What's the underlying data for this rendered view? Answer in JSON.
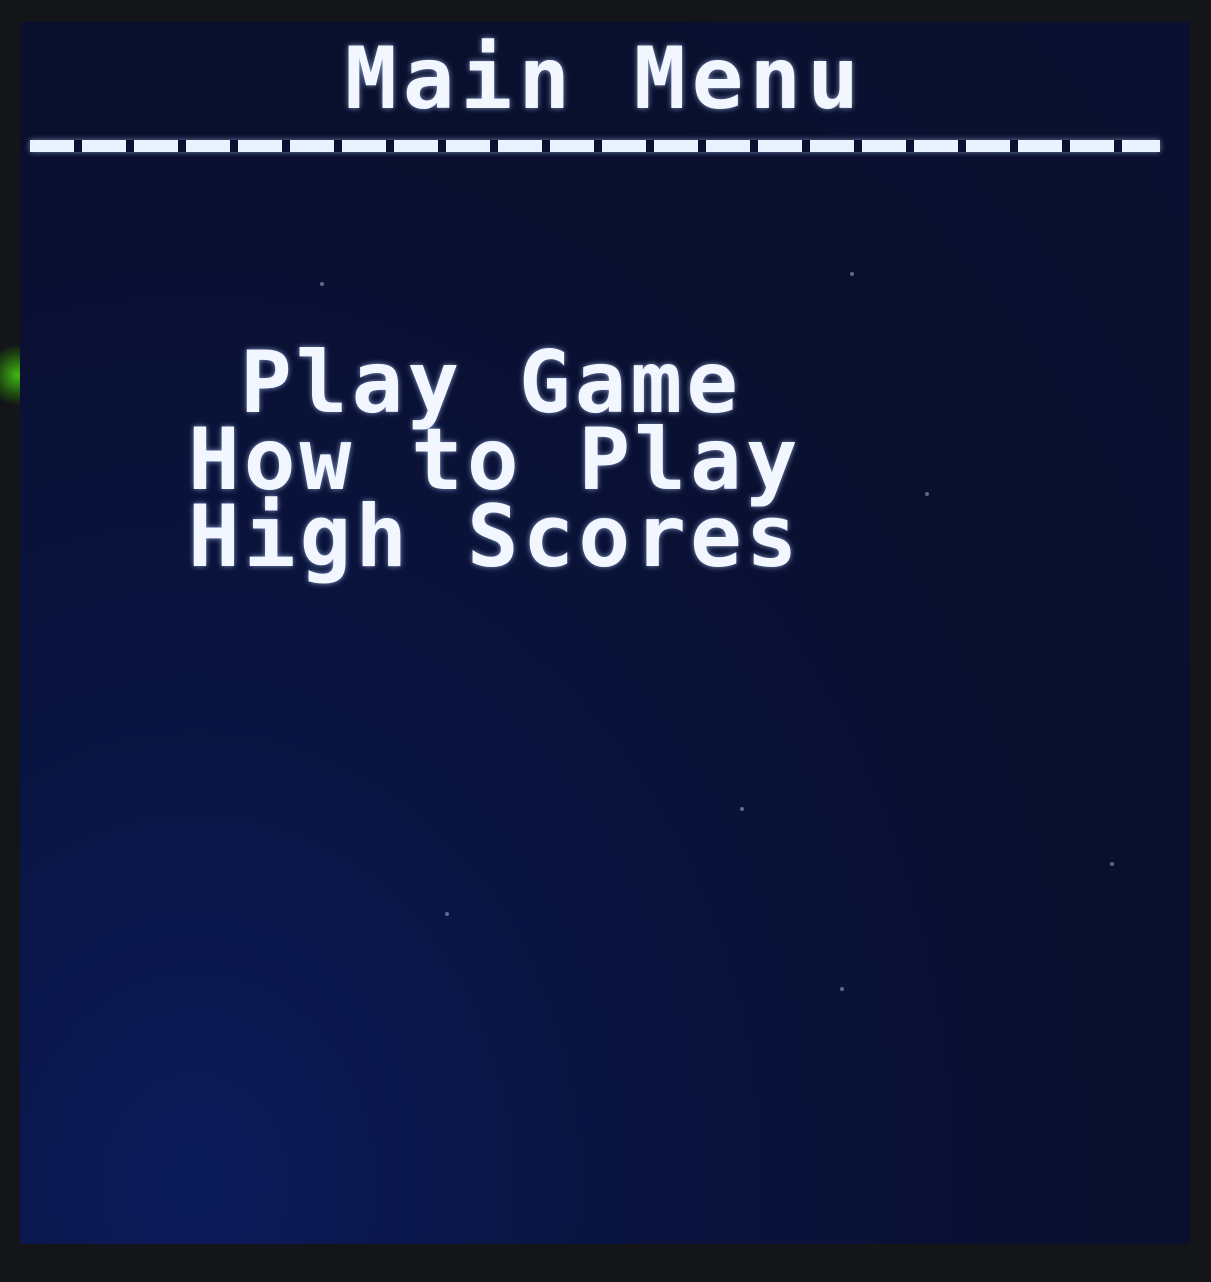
{
  "screen": {
    "title": "Main Menu",
    "menu": {
      "items": [
        {
          "label": "Play Game"
        },
        {
          "label": "How to Play"
        },
        {
          "label": "High Scores"
        }
      ]
    }
  },
  "colors": {
    "background": "#0a0f2e",
    "text": "#f2f6ff",
    "bezel": "#141518",
    "power_led": "#46c814"
  }
}
